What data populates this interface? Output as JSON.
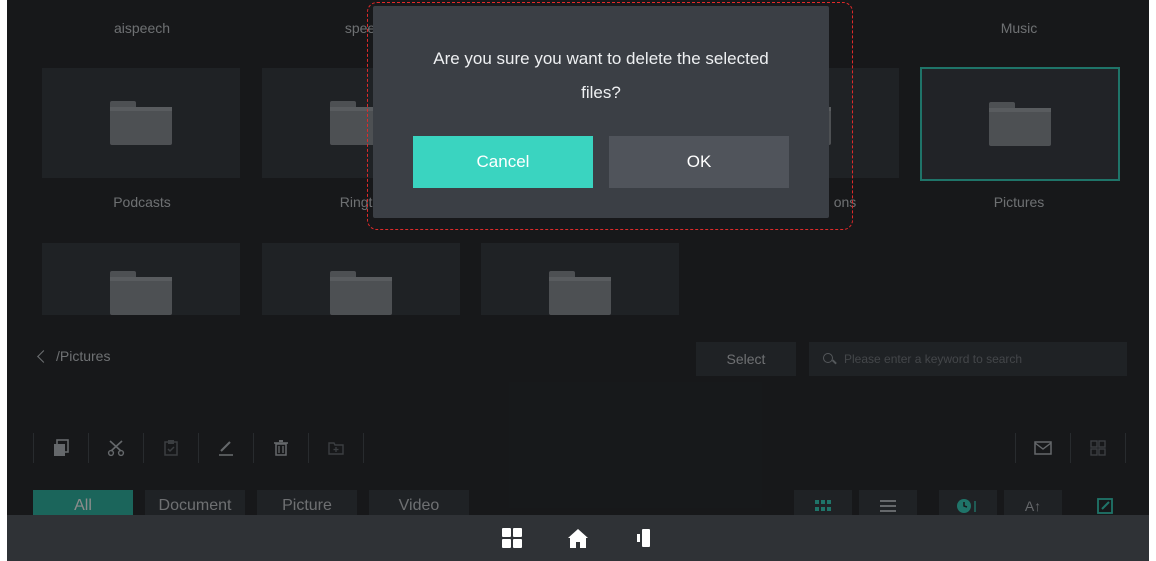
{
  "folders_row1_names": [
    "aispeech",
    "spee",
    "",
    "",
    "Music"
  ],
  "folders_row2_names": [
    "Podcasts",
    "Ringto",
    "",
    "ons",
    "Pictures"
  ],
  "path": {
    "label": "/Pictures"
  },
  "select_label": "Select",
  "search": {
    "placeholder": "Please enter a keyword to search"
  },
  "toolbar": {
    "copy_icon": "copy-icon",
    "cut_icon": "scissors-icon",
    "paste_icon": "paste-icon",
    "rename_icon": "pencil-icon",
    "delete_icon": "trash-icon",
    "new_folder_icon": "folder-plus-icon",
    "mail_icon": "mail-icon",
    "multi_select_icon": "grid-select-icon"
  },
  "filters": {
    "all": "All",
    "document": "Document",
    "picture": "Picture",
    "video": "Video"
  },
  "view_controls": {
    "sort_name": "A↑"
  },
  "dialog": {
    "message": "Are you sure you want to delete the selected files?",
    "cancel": "Cancel",
    "ok": "OK"
  },
  "colors": {
    "accent": "#3ad4c0",
    "background": "#2a2d31",
    "dialog": "#3b3f45",
    "highlight_outline": "#e02a2a"
  }
}
